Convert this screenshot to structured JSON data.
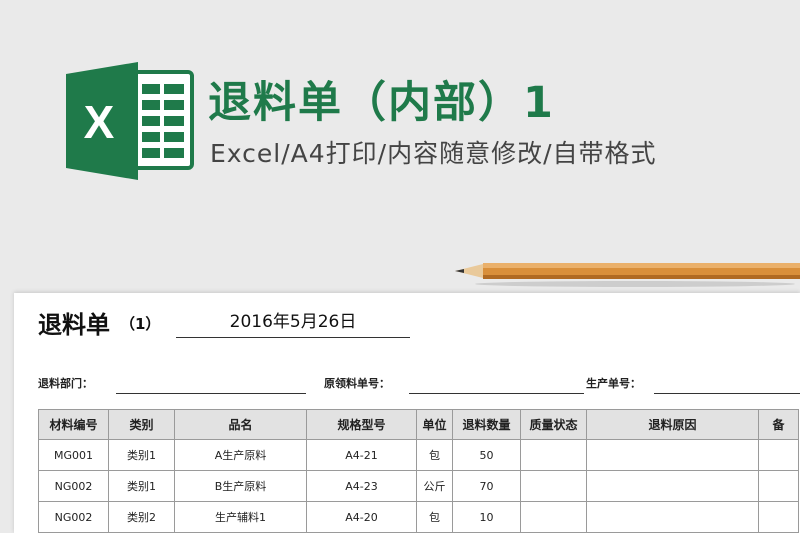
{
  "banner": {
    "title": "退料单（内部）1",
    "subtitle": "Excel/A4打印/内容随意修改/自带格式",
    "logo_letter": "X"
  },
  "colors": {
    "excel_green": "#1f7a4a",
    "excel_dark": "#185c37",
    "header_bg": "#e2e2e2"
  },
  "document": {
    "title": "退料单",
    "number": "（1）",
    "date": "2016年5月26日",
    "fields": [
      {
        "label": "退料部门："
      },
      {
        "label": "原领料单号："
      },
      {
        "label": "生产单号："
      }
    ],
    "columns": [
      "材料编号",
      "类别",
      "品名",
      "规格型号",
      "单位",
      "退料数量",
      "质量状态",
      "退料原因",
      "备"
    ],
    "rows": [
      [
        "MG001",
        "类别1",
        "A生产原料",
        "A4-21",
        "包",
        "50",
        "",
        "",
        ""
      ],
      [
        "NG002",
        "类别1",
        "B生产原料",
        "A4-23",
        "公斤",
        "70",
        "",
        "",
        ""
      ],
      [
        "NG002",
        "类别2",
        "生产辅料1",
        "A4-20",
        "包",
        "10",
        "",
        "",
        ""
      ]
    ]
  }
}
